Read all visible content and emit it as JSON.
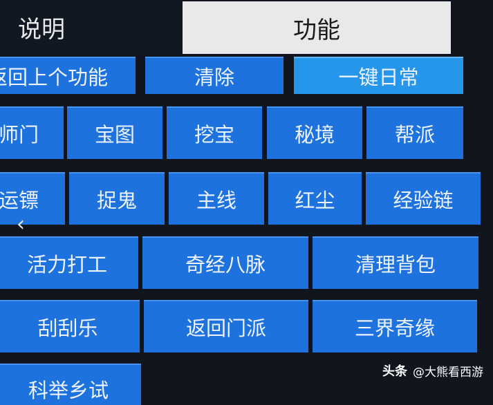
{
  "tabs": {
    "info_label": "说明",
    "function_label": "功能"
  },
  "rows": {
    "r0": [
      "返回上个功能",
      "清除",
      "一键日常"
    ],
    "r1": [
      "师门",
      "宝图",
      "挖宝",
      "秘境",
      "帮派"
    ],
    "r2": [
      "运镖",
      "捉鬼",
      "主线",
      "红尘",
      "经验链"
    ],
    "r3": [
      "活力打工",
      "奇经八脉",
      "清理背包"
    ],
    "r4": [
      "刮刮乐",
      "返回门派",
      "三界奇缘"
    ],
    "r5": [
      "科举乡试"
    ]
  },
  "back_arrow": "‹",
  "watermark": {
    "brand": "头条",
    "handle": "@大熊看西游"
  },
  "colors": {
    "button": "#1e72de",
    "button_highlight": "#2596e9",
    "background": "#10151e"
  }
}
